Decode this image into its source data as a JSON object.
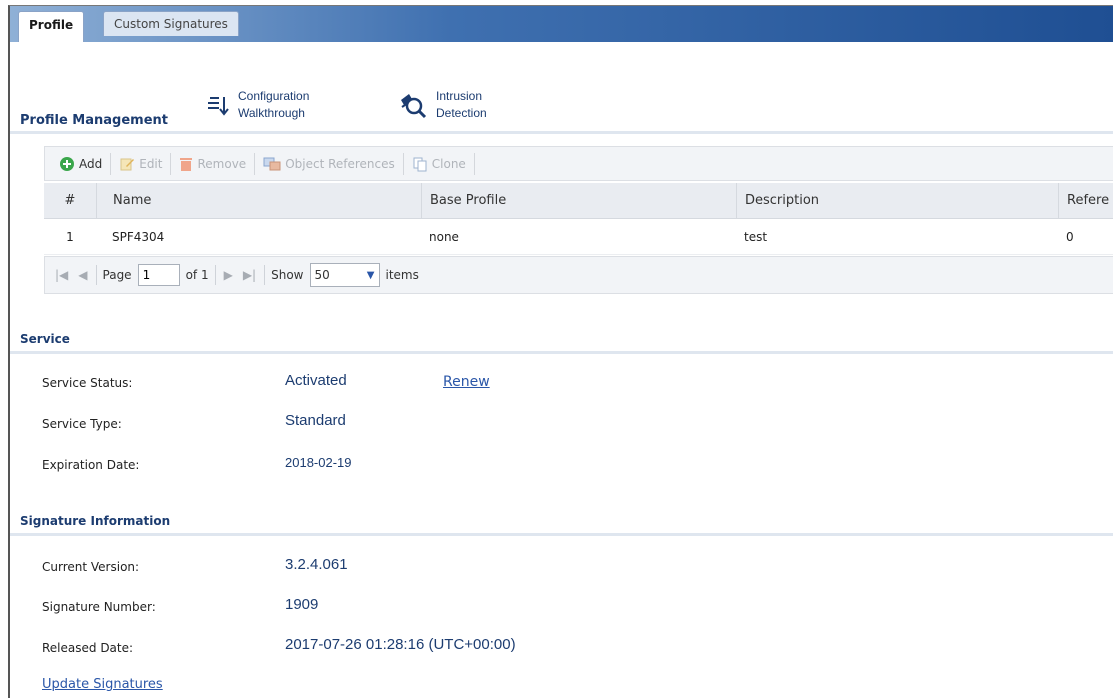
{
  "tabs": [
    {
      "label": "Profile"
    },
    {
      "label": "Custom Signatures"
    }
  ],
  "profile_management": {
    "title": "Profile Management",
    "quick_links": [
      {
        "label_line1": "Configuration",
        "label_line2": "Walkthrough",
        "icon": "walkthrough-icon"
      },
      {
        "label_line1": "Intrusion",
        "label_line2": "Detection",
        "icon": "intrusion-icon"
      }
    ]
  },
  "toolbar": {
    "add": "Add",
    "edit": "Edit",
    "remove": "Remove",
    "object_references": "Object References",
    "clone": "Clone"
  },
  "table": {
    "columns": [
      "#",
      "Name",
      "Base Profile",
      "Description",
      "Refere"
    ],
    "rows": [
      {
        "index": "1",
        "name": "SPF4304",
        "base_profile": "none",
        "description": "test",
        "references": "0"
      }
    ]
  },
  "pager": {
    "page_label": "Page",
    "page_value": "1",
    "of_label": "of 1",
    "show_label": "Show",
    "show_value": "50",
    "items_label": "items"
  },
  "service": {
    "title": "Service",
    "status_label": "Service Status:",
    "status_value": "Activated",
    "renew_link": "Renew",
    "type_label": "Service Type:",
    "type_value": "Standard",
    "expiration_label": "Expiration Date:",
    "expiration_value": "2018-02-19"
  },
  "signature_info": {
    "title": "Signature Information",
    "current_version_label": "Current Version:",
    "current_version_value": "3.2.4.061",
    "signature_number_label": "Signature Number:",
    "signature_number_value": "1909",
    "released_date_label": "Released Date:",
    "released_date_value": "2017-07-26 01:28:16 (UTC+00:00)",
    "update_link": "Update Signatures"
  },
  "colors": {
    "accent": "#1c3c70",
    "link": "#2a56a8",
    "tabbar_dark": "#1f4f93"
  }
}
